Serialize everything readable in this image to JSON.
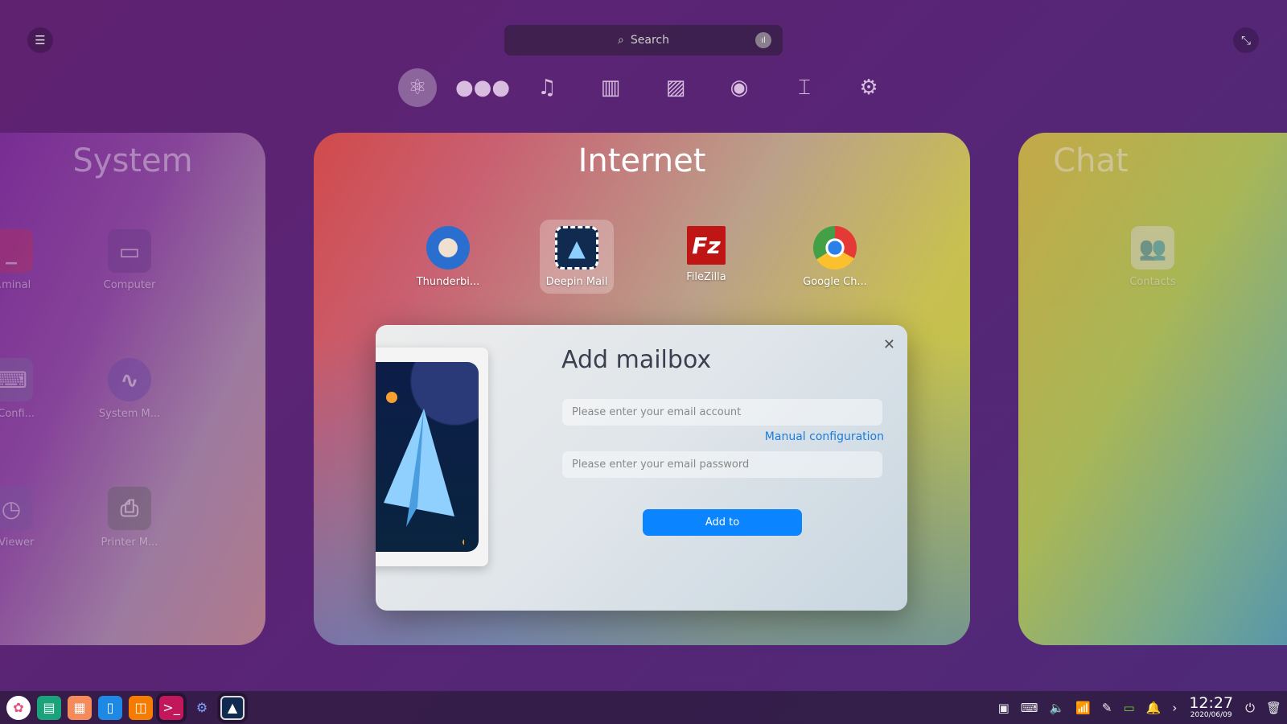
{
  "top": {
    "search_placeholder": "Search",
    "menu_icon": "list-icon",
    "exit_icon": "exit-fullscreen-icon",
    "mic_icon": "voice-icon"
  },
  "categories": [
    {
      "name": "internet",
      "icon": "⚛",
      "active": true
    },
    {
      "name": "chat",
      "icon": "💬"
    },
    {
      "name": "music",
      "icon": "♫"
    },
    {
      "name": "video",
      "icon": "🎞"
    },
    {
      "name": "graphics",
      "icon": "🖼"
    },
    {
      "name": "games",
      "icon": "🎮"
    },
    {
      "name": "office",
      "icon": "📽"
    },
    {
      "name": "system",
      "icon": "⚙"
    }
  ],
  "panels": {
    "system": {
      "title": "System",
      "apps": [
        "...minal",
        "Computer",
        "...Confi...",
        "System M...",
        "...Viewer",
        "Printer M..."
      ]
    },
    "internet": {
      "title": "Internet",
      "apps": [
        "Thunderbi...",
        "Deepin Mail",
        "FileZilla",
        "Google Ch..."
      ]
    },
    "chat": {
      "title": "Chat",
      "apps": [
        "Contacts"
      ]
    }
  },
  "dialog": {
    "title": "Add mailbox",
    "email_placeholder": "Please enter your email account",
    "manual": "Manual configuration",
    "password_placeholder": "Please enter your email password",
    "button": "Add to"
  },
  "taskbar": {
    "time": "12:27",
    "date": "2020/06/09"
  },
  "colors": {
    "accent": "#0a84ff",
    "link": "#1a7cdc"
  }
}
